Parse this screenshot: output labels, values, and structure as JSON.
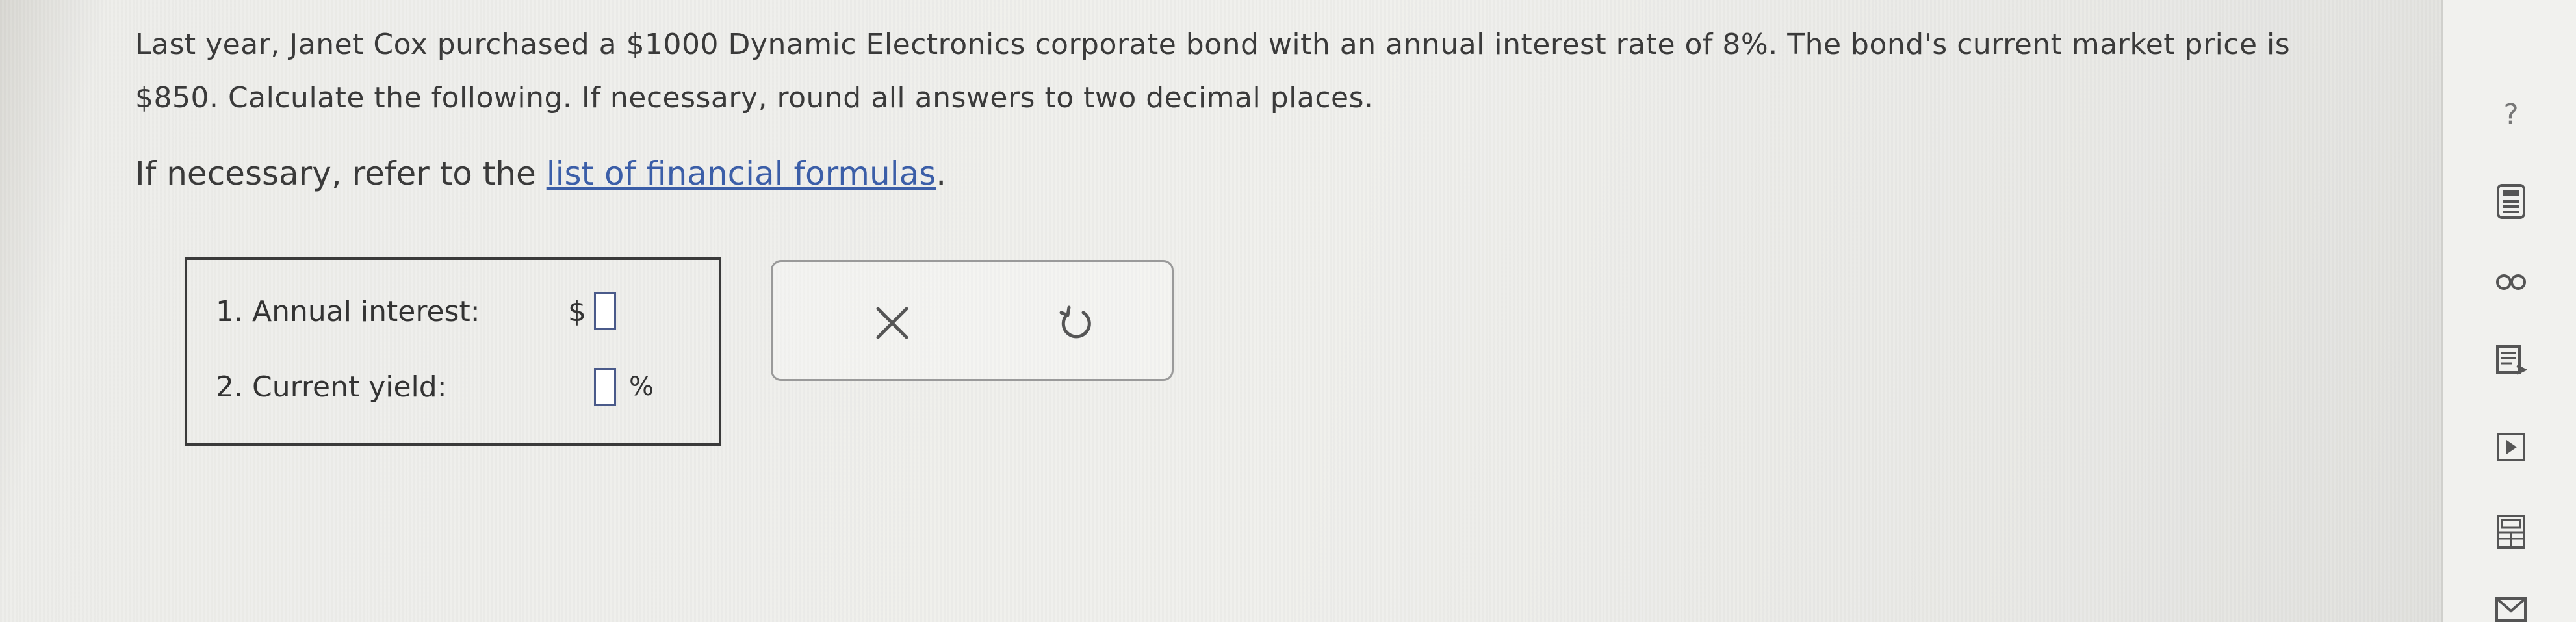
{
  "question": {
    "line1": "Last year, Janet Cox purchased a $1000 Dynamic Electronics corporate bond with an annual interest rate of 8%. The bond's current market price is",
    "line2": "$850. Calculate the following. If necessary, round all answers to two decimal places."
  },
  "formulas": {
    "prefix": "If necessary, refer to the ",
    "link": "list of financial formulas",
    "suffix": "."
  },
  "answers": {
    "annual_interest_label": "1. Annual interest:",
    "annual_interest_currency": "$",
    "annual_interest_value": "",
    "current_yield_label": "2. Current yield:",
    "current_yield_value": "",
    "current_yield_unit": "%"
  },
  "tools": {
    "clear_icon": "x-icon",
    "undo_icon": "undo-icon"
  },
  "sidebar": {
    "help_symbol": "?",
    "icons": [
      "help-icon",
      "calculator-icon",
      "glossary-icon",
      "textbook-icon",
      "video-icon",
      "table-icon",
      "mail-icon"
    ]
  },
  "colors": {
    "link": "#3b5ea8",
    "input_border": "#4a5a8a",
    "text": "#3a3a3a"
  }
}
